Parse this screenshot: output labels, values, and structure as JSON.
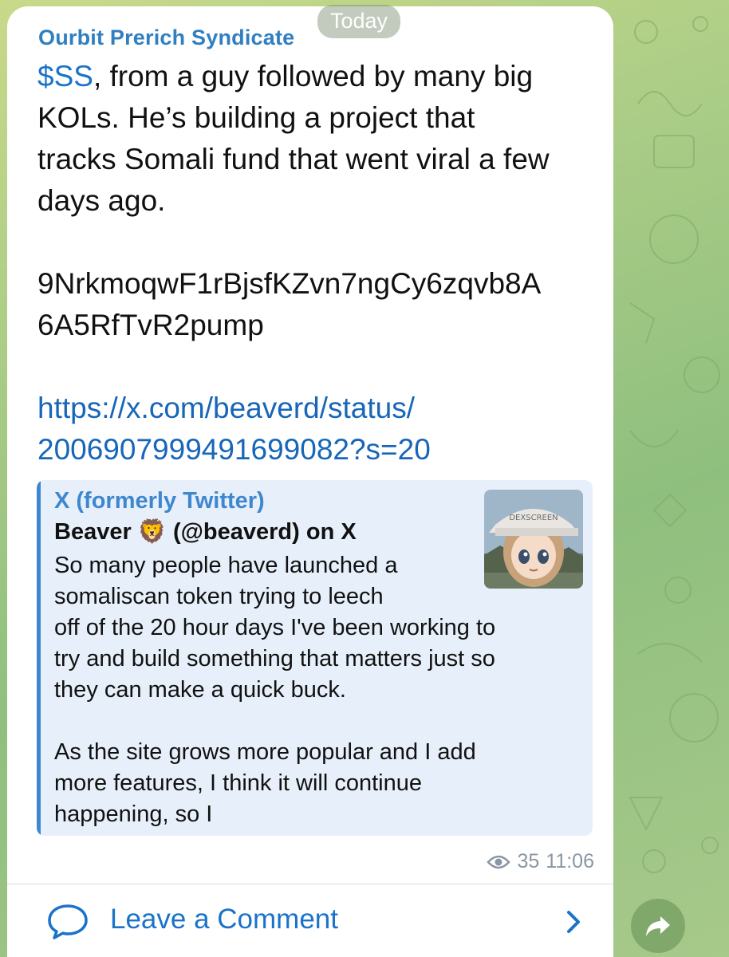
{
  "date_badge": "Today",
  "channel_name": "Ourbit Prerich Syndicate",
  "message": {
    "ticker": "$SS",
    "line1_rest": ", from a guy followed by many big",
    "line2": "KOLs. He’s building a project that",
    "line3": "tracks Somali fund that went viral a few",
    "line4": "days ago.",
    "address_line1": "9NrkmoqwF1rBjsfKZvn7ngCy6zqvb8A",
    "address_line2": "6A5RfTvR2pump",
    "link_line1": "https://x.com/beaverd/status/",
    "link_line2": "2006907999491699082?s=20"
  },
  "preview": {
    "site": "X (formerly Twitter)",
    "title_name": "Beaver",
    "title_emoji": "🦁",
    "title_rest": "(@beaverd) on X",
    "desc_lines": [
      "So many people have launched a",
      "somaliscan token trying to leech",
      "off of the 20 hour days I've been working to",
      "try and build something that matters just so",
      "they can make a quick buck.",
      "",
      "As the site grows more popular and I add",
      "more features, I think it will continue",
      "happening, so I"
    ],
    "thumbnail_cap_text": "DEXSCREEN"
  },
  "meta": {
    "views": "35",
    "time": "11:06"
  },
  "comment_button": {
    "label": "Leave a Comment"
  },
  "colors": {
    "accent": "#1a73c9",
    "channel_name": "#2f7fc1",
    "preview_bg": "#e7f0fa",
    "bubble_bg": "#ffffff"
  },
  "icons": {
    "views": "eye-icon",
    "comment": "speech-bubble-icon",
    "chevron": "chevron-right-icon",
    "share": "share-arrow-icon"
  }
}
